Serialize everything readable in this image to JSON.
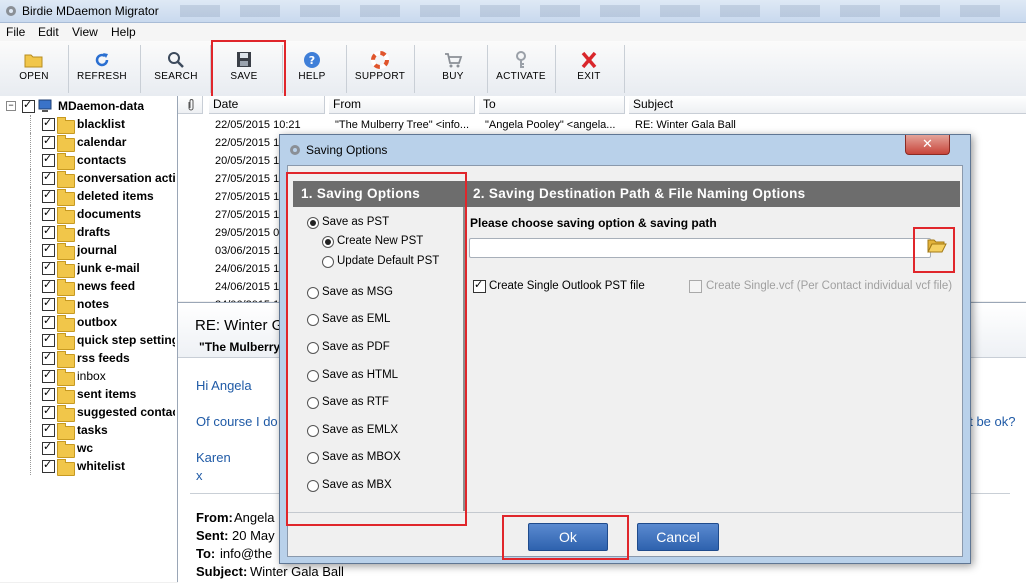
{
  "app": {
    "title": "Birdie MDaemon Migrator"
  },
  "menu": [
    {
      "label": "File"
    },
    {
      "label": "Edit"
    },
    {
      "label": "View"
    },
    {
      "label": "Help"
    }
  ],
  "toolbar": [
    {
      "label": "OPEN",
      "icon": "folder-icon"
    },
    {
      "label": "REFRESH",
      "icon": "refresh-icon"
    },
    {
      "label": "SEARCH",
      "icon": "search-icon"
    },
    {
      "label": "SAVE",
      "icon": "floppy-disk-icon"
    },
    {
      "label": "HELP",
      "icon": "help-icon"
    },
    {
      "label": "SUPPORT",
      "icon": "lifebuoy-icon"
    },
    {
      "label": "BUY",
      "icon": "cart-icon"
    },
    {
      "label": "ACTIVATE",
      "icon": "key-icon"
    },
    {
      "label": "EXIT",
      "icon": "close-icon"
    }
  ],
  "tree": {
    "root": "MDaemon-data",
    "folders": [
      "blacklist",
      "calendar",
      "contacts",
      "conversation acti",
      "deleted items",
      "documents",
      "drafts",
      "journal",
      "junk e-mail",
      "news feed",
      "notes",
      "outbox",
      "quick step setting",
      "rss feeds",
      "inbox",
      "sent items",
      "suggested contac",
      "tasks",
      "wc",
      "whitelist"
    ]
  },
  "grid": {
    "columns": [
      "Date",
      "From",
      "To",
      "Subject"
    ],
    "first_row": {
      "date": "22/05/2015 10:21",
      "from": "\"The Mulberry Tree\" <info...",
      "to": "\"Angela Pooley\" <angela...",
      "subject": "RE: Winter Gala Ball"
    },
    "dates": [
      "22/05/2015 1",
      "20/05/2015 1",
      "27/05/2015 1",
      "27/05/2015 1",
      "27/05/2015 1",
      "29/05/2015 0",
      "03/06/2015 1",
      "24/06/2015 1",
      "24/06/2015 1",
      "24/06/2015 1"
    ]
  },
  "preview": {
    "subject": "RE: Winter G",
    "from_display": "\"The Mulberry",
    "greeting": "Hi Angela",
    "body_left": "Of course I do",
    "body_right": "at be ok?",
    "sign_name": "Karen",
    "sign_x": "x",
    "from_label": "From:",
    "from_value": "Angela",
    "sent_label": "Sent:",
    "sent_value": "20 May",
    "to_label": "To:",
    "to_value": "info@the",
    "subject_label": "Subject:",
    "subject_value": "Winter Gala Ball"
  },
  "dialog": {
    "title": "Saving Options",
    "close": "✕",
    "left_header": "1. Saving Options",
    "right_header": "2. Saving Destination Path & File Naming Options",
    "options": [
      {
        "label": "Save as PST",
        "selected": true
      },
      {
        "label": "Save as MSG",
        "selected": false
      },
      {
        "label": "Save as EML",
        "selected": false
      },
      {
        "label": "Save as PDF",
        "selected": false
      },
      {
        "label": "Save as HTML",
        "selected": false
      },
      {
        "label": "Save as RTF",
        "selected": false
      },
      {
        "label": "Save as EMLX",
        "selected": false
      },
      {
        "label": "Save as MBOX",
        "selected": false
      },
      {
        "label": "Save as MBX",
        "selected": false
      }
    ],
    "pst_sub": [
      {
        "label": "Create New PST",
        "selected": true
      },
      {
        "label": "Update Default PST",
        "selected": false
      }
    ],
    "path_prompt": "Please choose saving option & saving path",
    "path_value": "",
    "single_pst_label": "Create Single Outlook PST file",
    "single_pst_checked": true,
    "single_vcf_label": "Create Single.vcf (Per Contact individual vcf file)",
    "single_vcf_checked": false,
    "ok_label": "Ok",
    "cancel_label": "Cancel"
  },
  "colors": {
    "highlight": "#e0262b",
    "header_gray": "#6d6d6d",
    "button_blue": "#2e62ae",
    "link_blue": "#1f5aa6"
  }
}
